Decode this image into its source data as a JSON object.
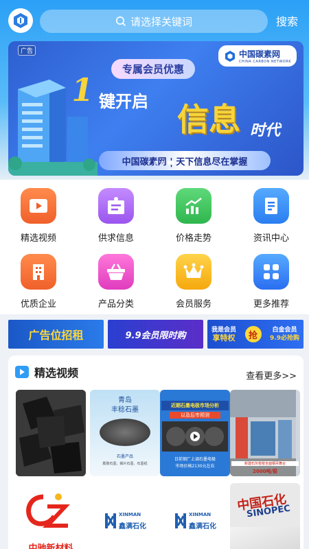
{
  "header": {
    "search_placeholder": "请选择关键词",
    "search_button": "搜索"
  },
  "banner": {
    "ad_tag": "广告",
    "brand_cn": "中国碳素网",
    "brand_en": "CHINA CARBON NETWORK",
    "pill": "专属会员优惠",
    "one": "1",
    "line1": "键开启",
    "big": "信息",
    "line2": "时代",
    "bottom": "中国碳素网 | 天下信息尽在掌握"
  },
  "grid": [
    {
      "label": "精选视频",
      "icon": "video-play-icon",
      "color": "#f2703a"
    },
    {
      "label": "供求信息",
      "icon": "notice-board-icon",
      "color": "#a464ef"
    },
    {
      "label": "价格走势",
      "icon": "trend-chart-icon",
      "color": "#3fc25d"
    },
    {
      "label": "资讯中心",
      "icon": "document-icon",
      "color": "#2f8ef5"
    },
    {
      "label": "优质企业",
      "icon": "building-icon",
      "color": "#f2703a"
    },
    {
      "label": "产品分类",
      "icon": "basket-icon",
      "color": "#ea4bc6"
    },
    {
      "label": "会员服务",
      "icon": "crown-icon",
      "color": "#f7b91c"
    },
    {
      "label": "更多推荐",
      "icon": "grid-apps-icon",
      "color": "#2f7df5"
    }
  ],
  "ads": {
    "a1": "广告位招租",
    "a2": "9.9会员限时购",
    "a3_1": "我是会员",
    "a3_2": "享特权",
    "a3_3": "抢",
    "a3_4": "白金会员",
    "a3_5": "9.9必抢购"
  },
  "videos": {
    "title": "精选视频",
    "more": "查看更多>>",
    "thumbs": [
      {
        "t1": "",
        "t2": ""
      },
      {
        "t1": "青岛",
        "t2": "丰稔石墨",
        "t3": "石墨产品",
        "t4": "膨胀石墨、鳞片石墨、石墨纸"
      },
      {
        "t1": "近期石墨电极市场分析",
        "t2": "以及后市预测",
        "t3": "日前钢厂上调石墨电极",
        "t4": "市场价格2130元左右"
      },
      {
        "t1": "新建石灰窑窑全面钢吊舞台",
        "t2": "2000吨/窑"
      },
      {
        "t1": "中驰新材料",
        "t2": ""
      },
      {
        "t1": "XINMAN",
        "t2": "鑫满石化"
      },
      {
        "t1": "XINMAN",
        "t2": "鑫满石化"
      },
      {
        "t1": "中国石化",
        "t2": "SINOPEC"
      }
    ]
  }
}
